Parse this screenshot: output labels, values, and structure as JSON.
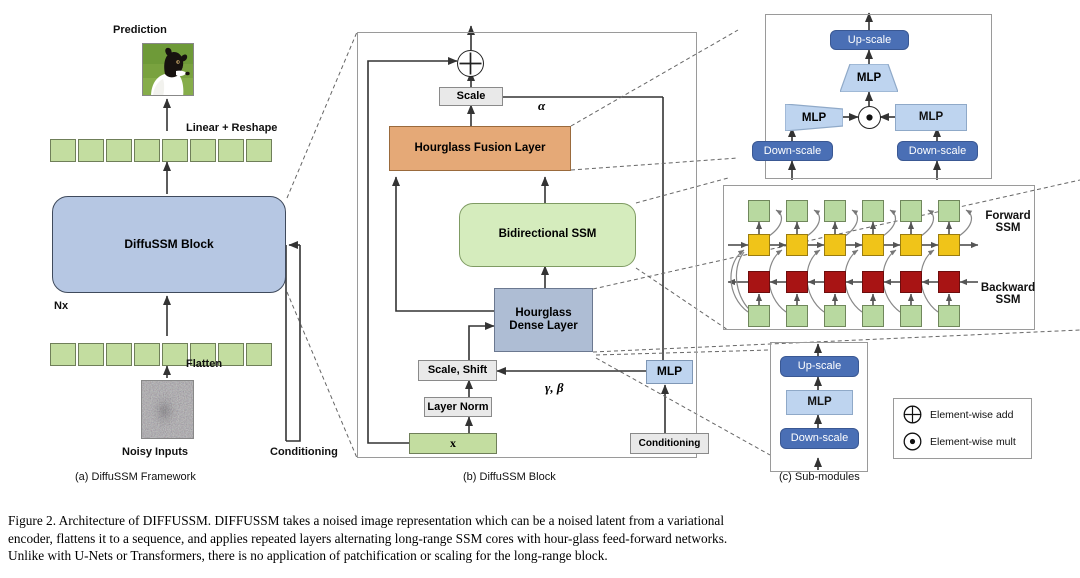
{
  "figure": {
    "caption_lines": [
      "Figure 2. Architecture of DIFFUSSM. DIFFUSSM takes a noised image representation which can be a noised latent from a variational",
      "encoder, flattens it to a sequence, and applies repeated layers alternating long-range SSM cores with hour-glass feed-forward networks.",
      "Unlike with U-Nets or Transformers, there is no application of patchification or scaling for the long-range block."
    ]
  },
  "panel_a": {
    "caption": "(a) DiffuSSM Framework",
    "prediction_label": "Prediction",
    "linear_reshape_label": "Linear + Reshape",
    "block_label": "DiffuSSM Block",
    "nx_label": "Nx",
    "flatten_label": "Flatten",
    "noisy_inputs_label": "Noisy Inputs",
    "conditioning_label": "Conditioning",
    "token_count": 8,
    "prediction_image": "border-collie-photo",
    "noisy_image": "gray-noise-photo"
  },
  "panel_b": {
    "caption": "(b) DiffuSSM Block",
    "add_node": "element-wise-add",
    "scale_label": "Scale",
    "alpha_label": "α",
    "fusion_label": "Hourglass Fusion Layer",
    "ssm_label": "Bidirectional SSM",
    "dense_label": "Hourglass\nDense Layer",
    "dense_label_line1": "Hourglass",
    "dense_label_line2": "Dense Layer",
    "scale_shift_label": "Scale, Shift",
    "layer_norm_label": "Layer Norm",
    "x_label": "x",
    "gamma_beta_label": "γ, β",
    "mlp_label": "MLP",
    "conditioning_label": "Conditioning"
  },
  "panel_c": {
    "caption": "(c) Sub-modules",
    "fusion_module": {
      "upscale_label": "Up-scale",
      "mlp_top_label": "MLP",
      "mlp_left_label": "MLP",
      "mlp_right_label": "MLP",
      "downscale_left_label": "Down-scale",
      "downscale_right_label": "Down-scale",
      "mult_node": "element-wise-mult"
    },
    "ssm_module": {
      "forward_label_line1": "Forward",
      "forward_label_line2": "SSM",
      "backward_label_line1": "Backward",
      "backward_label_line2": "SSM",
      "columns": 6,
      "top_row_color": "#b8d9a0",
      "forward_row_color": "#f0c419",
      "backward_row_color": "#a81414",
      "bottom_row_color": "#b8d9a0"
    },
    "dense_module": {
      "upscale_label": "Up-scale",
      "mlp_label": "MLP",
      "downscale_label": "Down-scale"
    },
    "legend": {
      "add_text": "Element-wise add",
      "mult_text": "Element-wise mult"
    }
  },
  "colors": {
    "green_token": "#c3dda0",
    "diffussm_block": "#b6c7e3",
    "orange_fusion": "#e5a977",
    "ssm_green": "#d5ecbd",
    "slate_dense": "#aebdd4",
    "light_blue": "#bed4ef",
    "dark_blue": "#4a6fb5",
    "gray_box": "#e9e9e9",
    "yellow": "#f0c419",
    "dark_red": "#a81414"
  }
}
